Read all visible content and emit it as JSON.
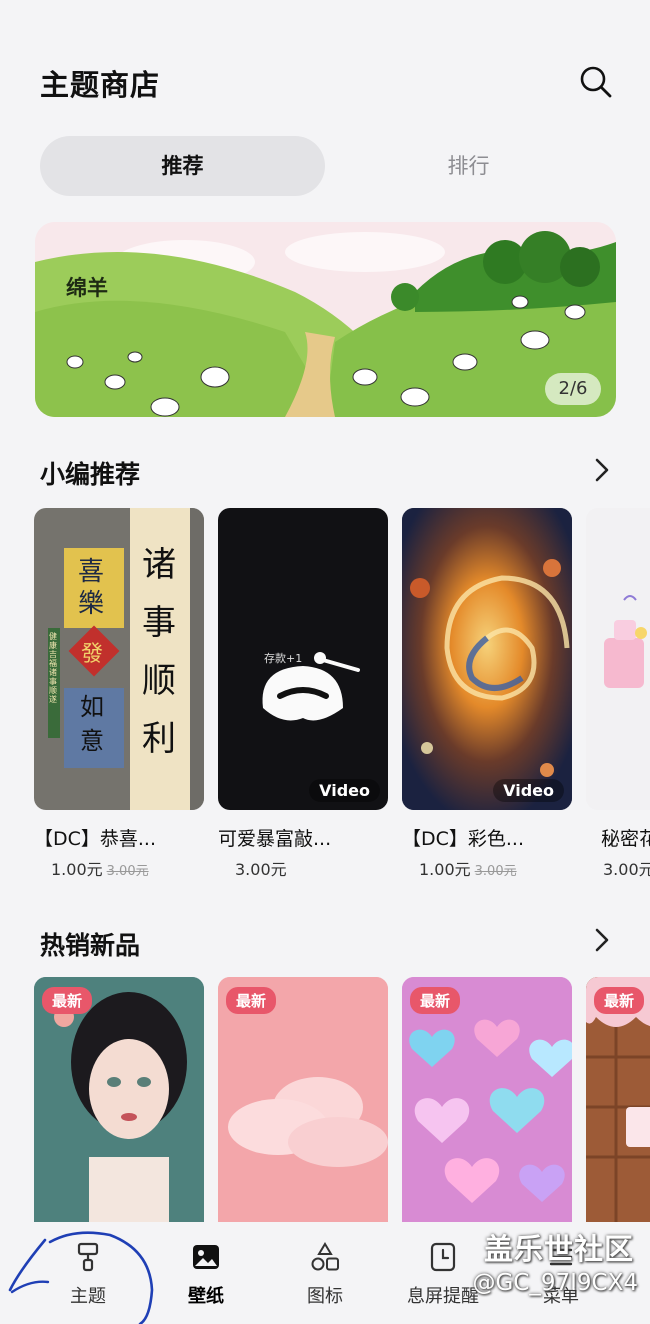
{
  "header": {
    "title": "主题商店"
  },
  "segments": {
    "recommend": "推荐",
    "ranking": "排行"
  },
  "banner": {
    "title": "绵羊",
    "page_indicator": "2/6"
  },
  "editor_picks": {
    "title": "小编推荐",
    "items": [
      {
        "name": "【DC】恭喜...",
        "price": "1.00元",
        "old_price": "3.00元",
        "video": ""
      },
      {
        "name": "可爱暴富敲...",
        "price": "3.00元",
        "old_price": "",
        "video": "Video"
      },
      {
        "name": "【DC】彩色...",
        "price": "1.00元",
        "old_price": "3.00元",
        "video": "Video"
      },
      {
        "name": "秘密花",
        "price": "3.00元",
        "old_price": "",
        "video": ""
      }
    ],
    "art_text": {
      "right_column": "诸事顺利",
      "left_top": "喜樂",
      "diamond": "發",
      "left_bottom": "如意",
      "side": "健康吉福 诸事顺遂",
      "video_card": "存款+1"
    }
  },
  "new_hot": {
    "title": "热销新品",
    "badge": "最新"
  },
  "tabbar": {
    "items": [
      {
        "label": "主题",
        "icon": "brush-icon"
      },
      {
        "label": "壁纸",
        "icon": "image-icon"
      },
      {
        "label": "图标",
        "icon": "shapes-icon"
      },
      {
        "label": "息屏提醒",
        "icon": "clock-icon"
      },
      {
        "label": "菜单",
        "icon": "menu-icon"
      }
    ]
  },
  "watermark": {
    "line1": "盖乐世社区",
    "line2": "@GC_97I9CX4"
  },
  "colors": {
    "badge": "#e8576a",
    "active_segment": "#e3e3e6",
    "background": "#f4f4f6"
  }
}
